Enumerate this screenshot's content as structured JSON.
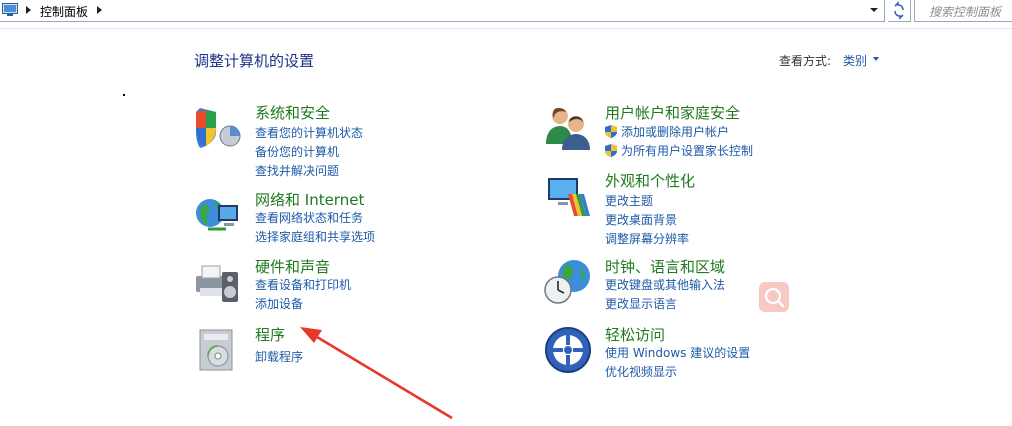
{
  "address_bar": {
    "breadcrumb": "控制面板",
    "search_placeholder": "搜索控制面板"
  },
  "header": {
    "title": "调整计算机的设置",
    "view_by_label": "查看方式:",
    "view_by_value": "类别"
  },
  "categories": [
    {
      "title": "系统和安全",
      "links": [
        "查看您的计算机状态",
        "备份您的计算机",
        "查找并解决问题"
      ]
    },
    {
      "title": "网络和 Internet",
      "links": [
        "查看网络状态和任务",
        "选择家庭组和共享选项"
      ]
    },
    {
      "title": "硬件和声音",
      "links": [
        "查看设备和打印机",
        "添加设备"
      ]
    },
    {
      "title": "程序",
      "links": [
        "卸载程序"
      ]
    },
    {
      "title": "用户帐户和家庭安全",
      "links": [
        "添加或删除用户帐户",
        "为所有用户设置家长控制"
      ]
    },
    {
      "title": "外观和个性化",
      "links": [
        "更改主题",
        "更改桌面背景",
        "调整屏幕分辨率"
      ]
    },
    {
      "title": "时钟、语言和区域",
      "links": [
        "更改键盘或其他输入法",
        "更改显示语言"
      ]
    },
    {
      "title": "轻松访问",
      "links": [
        "使用 Windows 建议的设置",
        "优化视频显示"
      ]
    }
  ],
  "colors": {
    "category_title": "#1e7a1e",
    "link": "#1e5aa8",
    "heading": "#1e3287",
    "annotation_arrow": "#e8382c"
  }
}
